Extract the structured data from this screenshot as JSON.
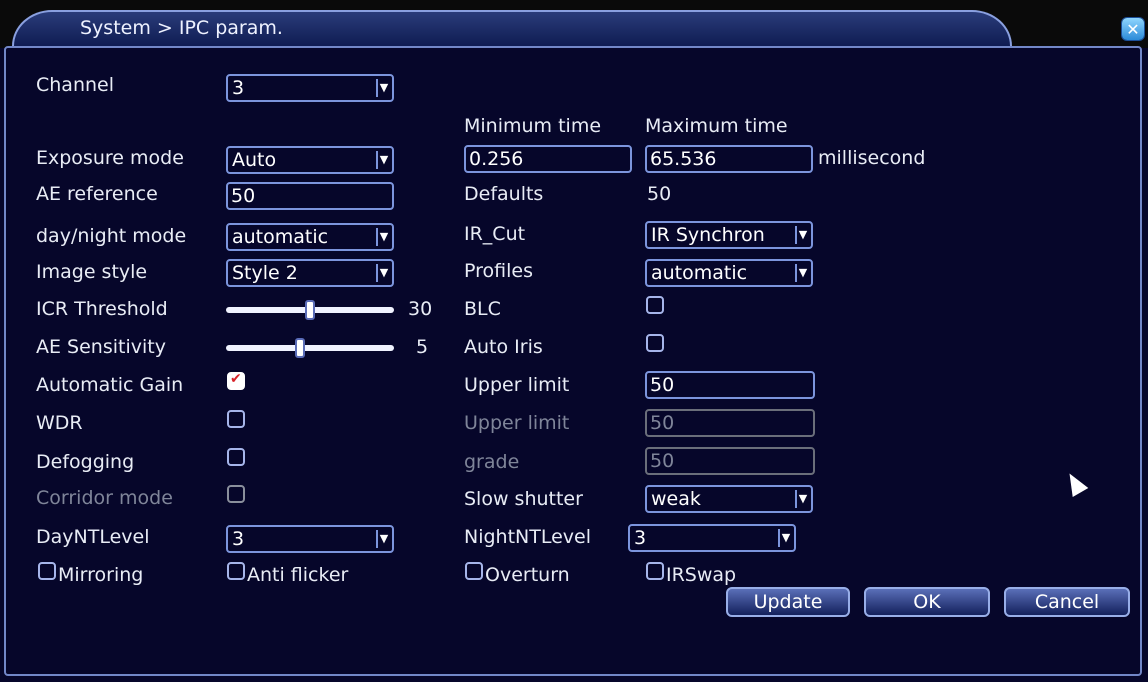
{
  "window": {
    "title": "System > IPC param."
  },
  "labels": {
    "channel": "Channel",
    "exposure_mode": "Exposure mode",
    "ae_reference": "AE reference",
    "day_night_mode": "day/night mode",
    "image_style": "Image style",
    "icr_threshold": "ICR Threshold",
    "ae_sensitivity": "AE Sensitivity",
    "automatic_gain": "Automatic Gain",
    "wdr": "WDR",
    "defogging": "Defogging",
    "corridor_mode": "Corridor mode",
    "day_nt_level": "DayNTLevel",
    "mirroring": "Mirroring",
    "anti_flicker": "Anti flicker",
    "minimum_time": "Minimum time",
    "maximum_time": "Maximum time",
    "millisecond": "millisecond",
    "defaults": "Defaults",
    "ir_cut": "IR_Cut",
    "profiles": "Profiles",
    "blc": "BLC",
    "auto_iris": "Auto Iris",
    "upper_limit_1": "Upper limit",
    "upper_limit_2": "Upper limit",
    "grade": "grade",
    "slow_shutter": "Slow shutter",
    "night_nt_level": "NightNTLevel",
    "overturn": "Overturn",
    "ir_swap": "IRSwap"
  },
  "values": {
    "channel": "3",
    "exposure_mode": "Auto",
    "ae_reference": "50",
    "day_night_mode": "automatic",
    "image_style": "Style 2",
    "icr_threshold": "30",
    "ae_sensitivity": "5",
    "minimum_time": "0.256",
    "maximum_time": "65.536",
    "defaults": "50",
    "ir_cut": "IR Synchron",
    "profiles": "automatic",
    "upper_limit_1": "50",
    "upper_limit_2": "50",
    "grade": "50",
    "slow_shutter": "weak",
    "day_nt_level": "3",
    "night_nt_level": "3"
  },
  "sliders": {
    "icr_threshold_fraction": 0.5,
    "ae_sensitivity_fraction": 0.44
  },
  "checkboxes": {
    "automatic_gain": true,
    "wdr": false,
    "defogging": false,
    "corridor_mode": false,
    "mirroring": false,
    "anti_flicker": false,
    "blc": false,
    "auto_iris": false,
    "overturn": false,
    "ir_swap": false
  },
  "buttons": {
    "update": "Update",
    "ok": "OK",
    "cancel": "Cancel"
  },
  "icons": {
    "close": "close-icon",
    "dropdown": "chevron-down-icon",
    "cursor": "mouse-pointer-icon"
  },
  "colors": {
    "background": "#06062a",
    "border": "#7c95dd",
    "text": "#e8ecf5",
    "dim": "#7f8599"
  }
}
